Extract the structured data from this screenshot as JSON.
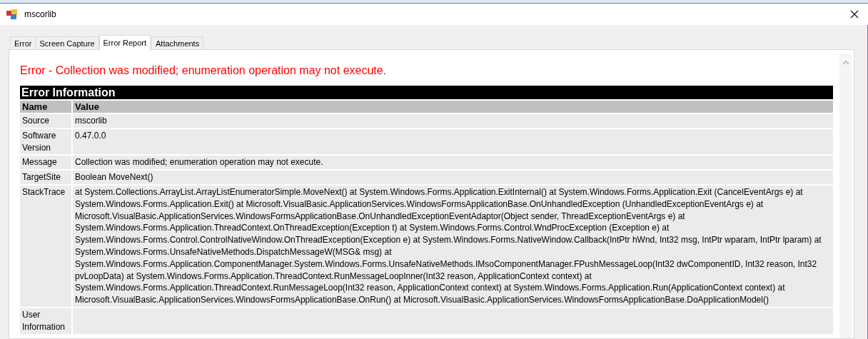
{
  "window": {
    "title": "mscorlib"
  },
  "tabs": [
    {
      "label": "Error",
      "selected": false
    },
    {
      "label": "Screen Capture",
      "selected": false
    },
    {
      "label": "Error Report",
      "selected": true
    },
    {
      "label": "Attachments",
      "selected": false
    }
  ],
  "report": {
    "heading": "Error - Collection was modified; enumeration operation may not execute.",
    "table": {
      "title": "Error Information",
      "columns": [
        "Name",
        "Value"
      ],
      "rows": [
        {
          "name": "Source",
          "value": "mscorlib"
        },
        {
          "name": "Software Version",
          "value": "0.47.0.0"
        },
        {
          "name": "Message",
          "value": "Collection was modified; enumeration operation may not execute."
        },
        {
          "name": "TargetSite",
          "value": "Boolean MoveNext()"
        },
        {
          "name": "StackTrace",
          "value": "at System.Collections.ArrayList.ArrayListEnumeratorSimple.MoveNext() at System.Windows.Forms.Application.ExitInternal() at System.Windows.Forms.Application.Exit (CancelEventArgs e) at System.Windows.Forms.Application.Exit() at Microsoft.VisualBasic.ApplicationServices.WindowsFormsApplicationBase.OnUnhandledException (UnhandledExceptionEventArgs e) at Microsoft.VisualBasic.ApplicationServices.WindowsFormsApplicationBase.OnUnhandledExceptionEventAdaptor(Object sender, ThreadExceptionEventArgs e) at System.Windows.Forms.Application.ThreadContext.OnThreadException(Exception t) at System.Windows.Forms.Control.WndProcException (Exception e) at System.Windows.Forms.Control.ControlNativeWindow.OnThreadException(Exception e) at System.Windows.Forms.NativeWindow.Callback(IntPtr hWnd, Int32 msg, IntPtr wparam, IntPtr lparam) at System.Windows.Forms.UnsafeNativeMethods.DispatchMessageW(MSG& msg) at System.Windows.Forms.Application.ComponentManager.System.Windows.Forms.UnsafeNativeMethods.IMsoComponentManager.FPushMessageLoop(Int32 dwComponentID, Int32 reason, Int32 pvLoopData) at System.Windows.Forms.Application.ThreadContext.RunMessageLoopInner(Int32 reason, ApplicationContext context) at System.Windows.Forms.Application.ThreadContext.RunMessageLoop(Int32 reason, ApplicationContext context) at System.Windows.Forms.Application.Run(ApplicationContext context) at Microsoft.VisualBasic.ApplicationServices.WindowsFormsApplicationBase.OnRun() at Microsoft.VisualBasic.ApplicationServices.WindowsFormsApplicationBase.DoApplicationModel()"
        },
        {
          "name": "User Information",
          "value": ""
        }
      ]
    }
  }
}
